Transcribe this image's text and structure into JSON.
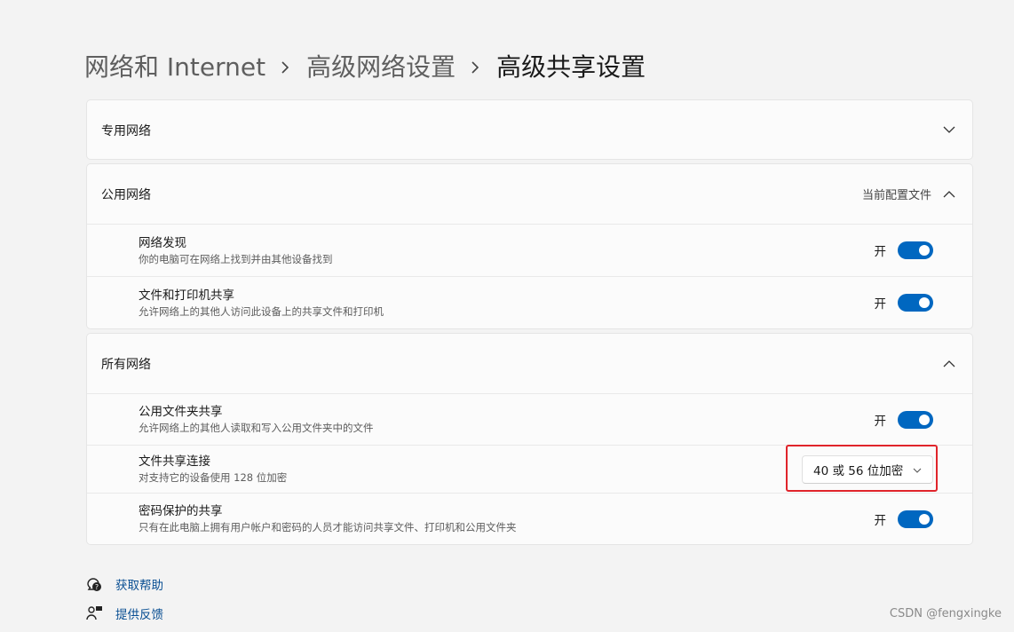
{
  "breadcrumb": {
    "items": [
      "网络和 Internet",
      "高级网络设置"
    ],
    "current": "高级共享设置"
  },
  "private_network": {
    "title": "专用网络"
  },
  "public_network": {
    "title": "公用网络",
    "status": "当前配置文件",
    "rows": [
      {
        "label": "网络发现",
        "desc": "你的电脑可在网络上找到并由其他设备找到",
        "toggle_text": "开",
        "on": true
      },
      {
        "label": "文件和打印机共享",
        "desc": "允许网络上的其他人访问此设备上的共享文件和打印机",
        "toggle_text": "开",
        "on": true
      }
    ]
  },
  "all_networks": {
    "title": "所有网络",
    "public_folder": {
      "label": "公用文件夹共享",
      "desc": "允许网络上的其他人读取和写入公用文件夹中的文件",
      "toggle_text": "开",
      "on": true
    },
    "file_sharing": {
      "label": "文件共享连接",
      "desc": "对支持它的设备使用 128 位加密",
      "selected": "40 或 56 位加密"
    },
    "password": {
      "label": "密码保护的共享",
      "desc": "只有在此电脑上拥有用户帐户和密码的人员才能访问共享文件、打印机和公用文件夹",
      "toggle_text": "开",
      "on": true
    }
  },
  "links": {
    "help": "获取帮助",
    "feedback": "提供反馈"
  },
  "watermark": "CSDN @fengxingke",
  "colors": {
    "accent": "#0067c0",
    "highlight": "#e0242b",
    "link": "#0a4f93"
  }
}
